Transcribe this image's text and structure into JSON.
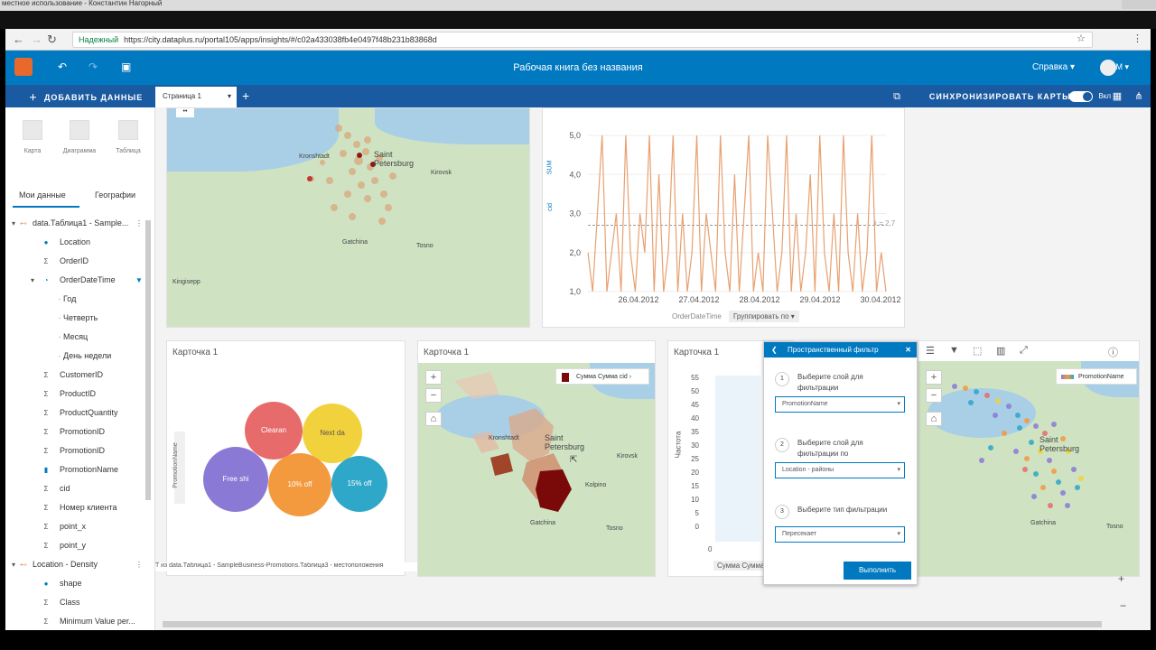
{
  "os": {
    "window_title": "местное использование - Константин Нагорный"
  },
  "browser": {
    "secure_label": "Надежный",
    "url": "https://city.dataplus.ru/portal105/apps/insights/#/c02a433038fb4e0497f48b231b83868d"
  },
  "app": {
    "title": "Рабочая книга без названия",
    "help": "Справка",
    "user_initial": "М"
  },
  "toolbar": {
    "add_data": "ДОБАВИТЬ ДАННЫЕ",
    "page_tab": "Страница 1",
    "sync_maps": "СИНХРОНИЗИРОВАТЬ КАРТЫ",
    "toggle_state": "Вкл"
  },
  "sidebar": {
    "tools": [
      {
        "label": "Карта"
      },
      {
        "label": "Диаграмма"
      },
      {
        "label": "Таблица"
      }
    ],
    "tabs": [
      "Мои данные",
      "Географии"
    ],
    "dataset": "data.Таблица1 - Sample...",
    "fields": [
      "Location",
      "OrderID",
      "OrderDateTime",
      "Год",
      "Четверть",
      "Месяц",
      "День недели",
      "CustomerID",
      "ProductID",
      "ProductQuantity",
      "PromotionID",
      "PromotionID",
      "PromotionName",
      "cid",
      "Номер клиента",
      "point_x",
      "point_y"
    ],
    "dataset2": "Location - Density",
    "fields2": [
      "shape",
      "Class",
      "Minimum Value per..."
    ]
  },
  "top_map": {
    "places": [
      "Kronshtadt",
      "Saint Petersburg",
      "Kirovsk",
      "Gatchina",
      "Tosno",
      "Kingisepp"
    ]
  },
  "line_chart": {
    "y_ticks": [
      "5,0",
      "4,0",
      "3,0",
      "2,0",
      "1,0"
    ],
    "x_ticks": [
      "26.04.2012",
      "27.04.2012",
      "28.04.2012",
      "29.04.2012",
      "30.04.2012"
    ],
    "x_field": "OrderDateTime",
    "group_by": "Группировать по",
    "y_field_sum": "SUM",
    "y_field": "cid",
    "mean_label": "x̄ = 2,7"
  },
  "bubble_card": {
    "title": "Карточка 1",
    "axis": "PromotionName",
    "bubbles": [
      "Clearan",
      "Next da",
      "Free shi",
      "10% off",
      "15% off"
    ],
    "footer": "T из data.Таблица1 - SampleBusiness-Promotions.Таблица3 - местоположения"
  },
  "density_map": {
    "title": "Карточка 1",
    "legend": "Сумма Сумма cid",
    "places": [
      "Saint Petersburg",
      "Kronshtadt",
      "Kirovsk",
      "Gatchina",
      "Tosno",
      "Kolpino"
    ]
  },
  "histogram": {
    "title": "Карточка 1",
    "y_label": "Частота",
    "y_ticks": [
      "55",
      "50",
      "45",
      "40",
      "35",
      "30",
      "25",
      "20",
      "15",
      "10",
      "5",
      "0"
    ],
    "x_tick": "0",
    "x_field": "Сумма Сумма"
  },
  "filter_panel": {
    "title": "Пространственный фильтр",
    "step1": "Выберите слой для фильтрации",
    "step1_value": "PromotionName",
    "step2": "Выберите слой для фильтрации по",
    "step2_value": "Location - районы",
    "step3": "Выберите тип фильтрации",
    "step3_value": "Пересекает",
    "run": "Выполнить"
  },
  "promo_map": {
    "legend": "PromotionName",
    "places": [
      "Saint Petersburg",
      "Gatchina",
      "Tosno"
    ]
  },
  "colors": {
    "brand": "#0079c1",
    "toolbar": "#1a5aa0",
    "line": "#e8a070"
  }
}
